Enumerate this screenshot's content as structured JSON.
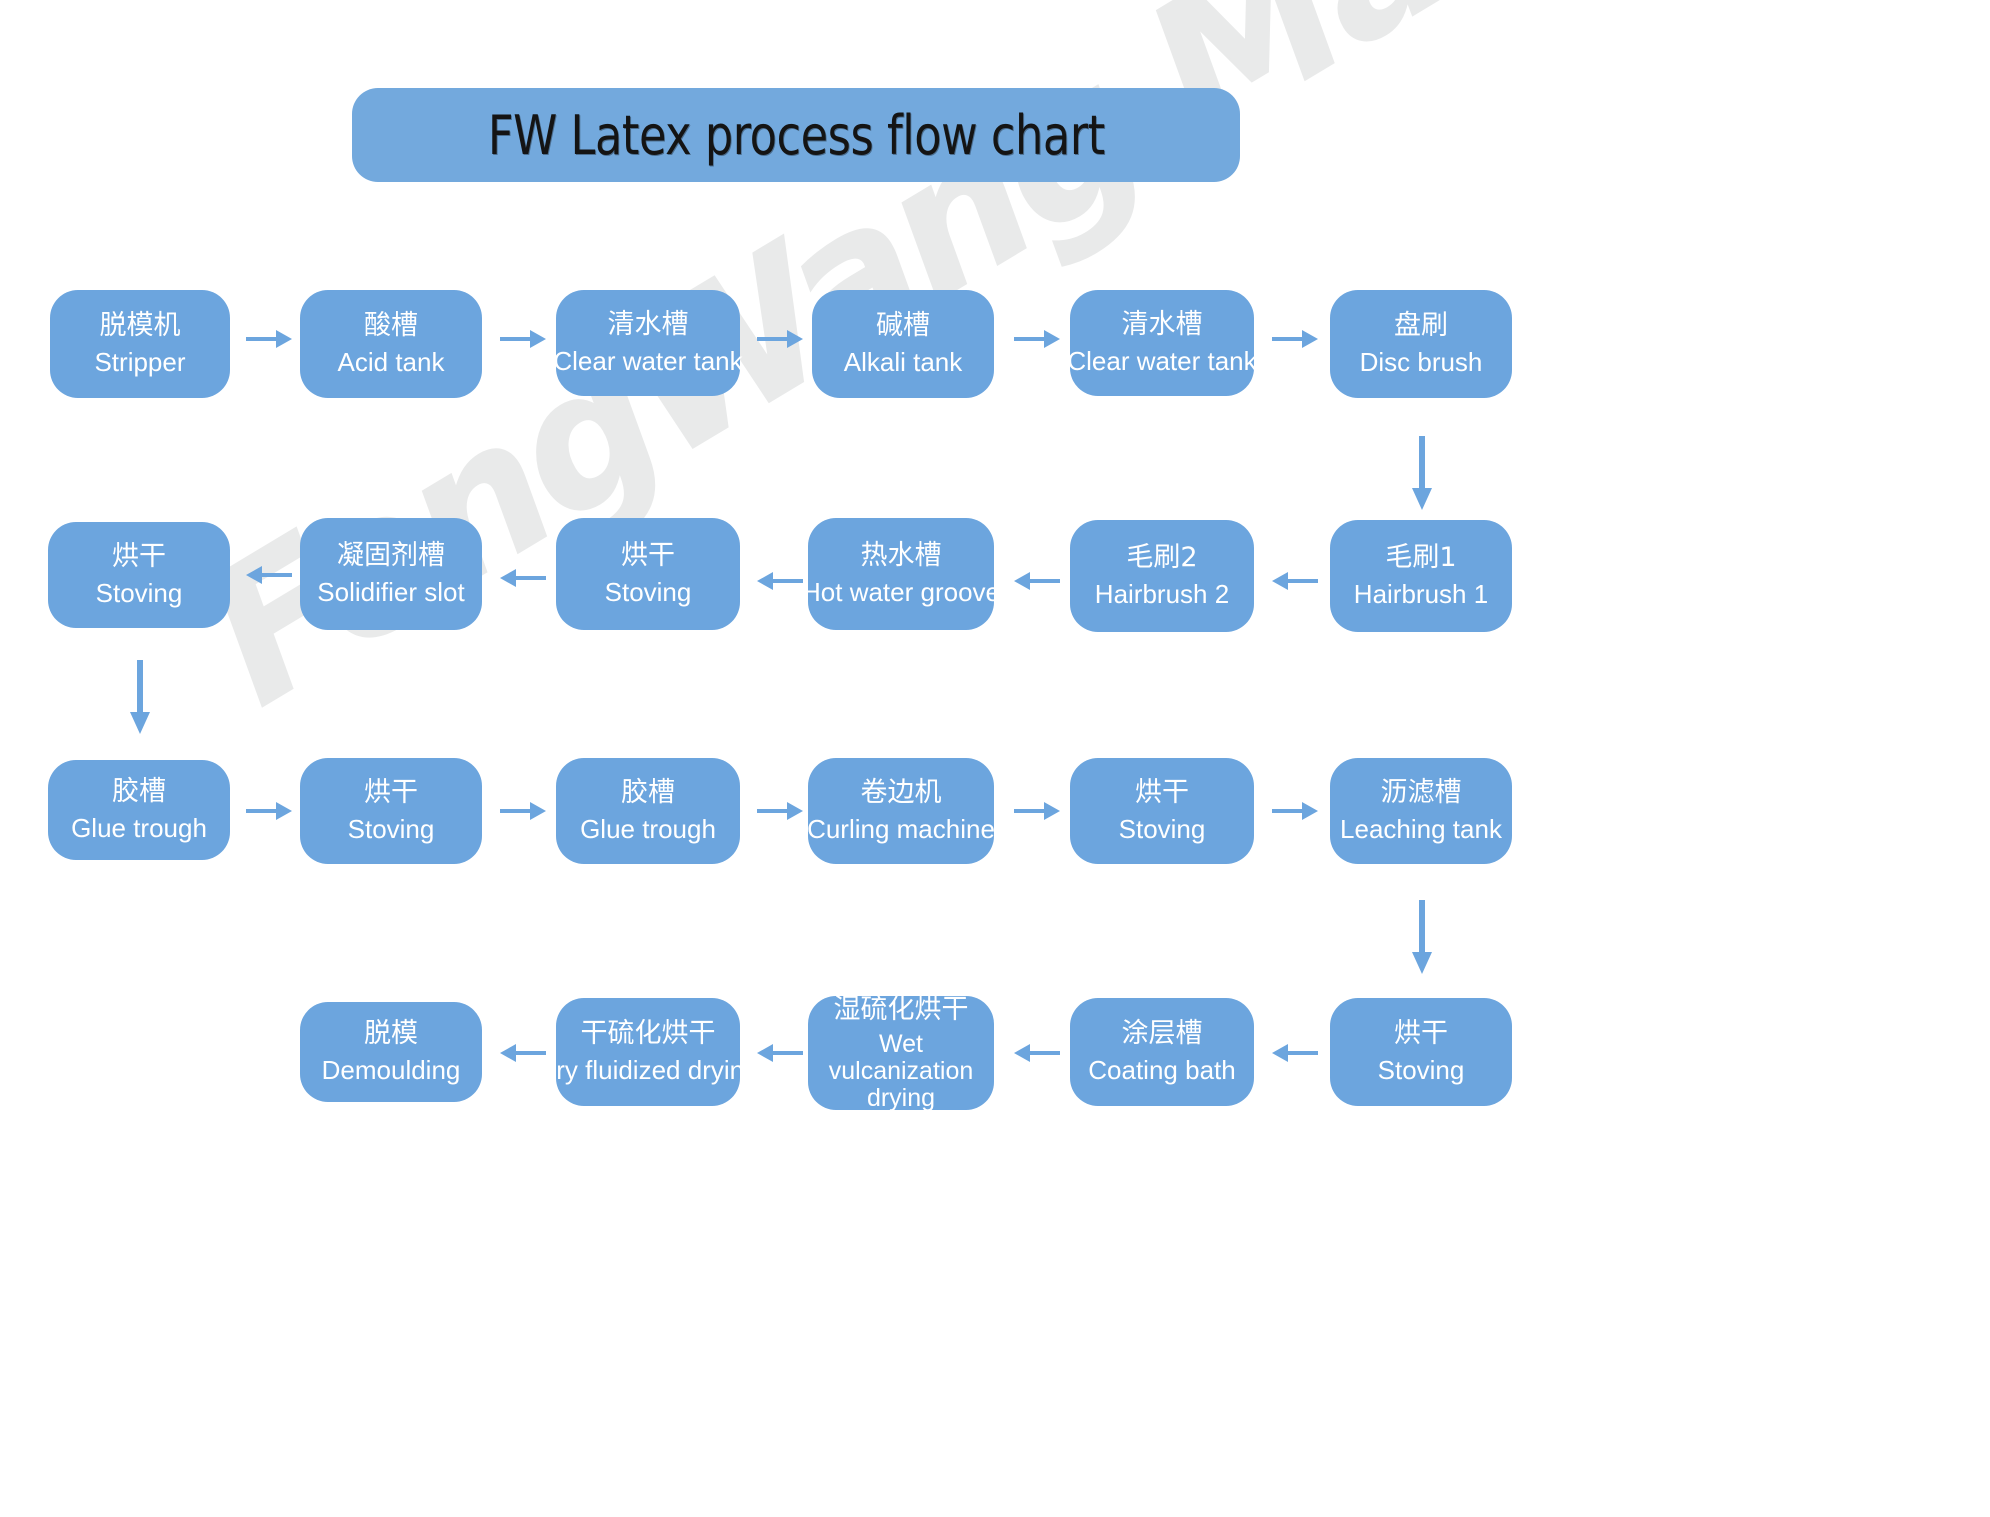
{
  "title": {
    "text": "FW Latex process flow chart"
  },
  "watermark": {
    "text": "FengWang Machinery",
    "color": "#e9eaea"
  },
  "colors": {
    "node_fill": "#6ca5de",
    "banner_fill": "#73a9dd",
    "arrow": "#6ca5de",
    "node_text": "#ffffff",
    "title_text": "#141414",
    "background": "#ffffff"
  },
  "rows": [
    {
      "id": "row-1",
      "direction": "left-to-right",
      "nodes": [
        {
          "cn": "脱模机",
          "en": "Stripper"
        },
        {
          "cn": "酸槽",
          "en": "Acid tank"
        },
        {
          "cn": "清水槽",
          "en": "Clear water tank"
        },
        {
          "cn": "碱槽",
          "en": "Alkali tank"
        },
        {
          "cn": "清水槽",
          "en": "Clear water tank"
        },
        {
          "cn": "盘刷",
          "en": "Disc brush"
        }
      ]
    },
    {
      "id": "row-2",
      "direction": "right-to-left",
      "nodes": [
        {
          "cn": "烘干",
          "en": "Stoving"
        },
        {
          "cn": "凝固剂槽",
          "en": "Solidifier slot"
        },
        {
          "cn": "烘干",
          "en": "Stoving"
        },
        {
          "cn": "热水槽",
          "en": "Hot water groove"
        },
        {
          "cn": "毛刷2",
          "en": "Hairbrush 2"
        },
        {
          "cn": "毛刷1",
          "en": "Hairbrush 1"
        }
      ]
    },
    {
      "id": "row-3",
      "direction": "left-to-right",
      "nodes": [
        {
          "cn": "胶槽",
          "en": "Glue trough"
        },
        {
          "cn": "烘干",
          "en": "Stoving"
        },
        {
          "cn": "胶槽",
          "en": "Glue trough"
        },
        {
          "cn": "卷边机",
          "en": "Curling machine"
        },
        {
          "cn": "烘干",
          "en": "Stoving"
        },
        {
          "cn": "沥滤槽",
          "en": "Leaching tank"
        }
      ]
    },
    {
      "id": "row-4",
      "direction": "right-to-left",
      "nodes": [
        {
          "cn": "脱模",
          "en": "Demoulding"
        },
        {
          "cn": "干硫化烘干",
          "en": "Dry fluidized drying"
        },
        {
          "cn": "湿硫化烘干",
          "en": "Wet vulcanization drying"
        },
        {
          "cn": "涂层槽",
          "en": "Coating bath"
        },
        {
          "cn": "烘干",
          "en": "Stoving"
        }
      ]
    }
  ],
  "connectors": {
    "down_right_1": "down-arrow",
    "down_left_1": "down-arrow",
    "down_right_2": "down-arrow"
  }
}
